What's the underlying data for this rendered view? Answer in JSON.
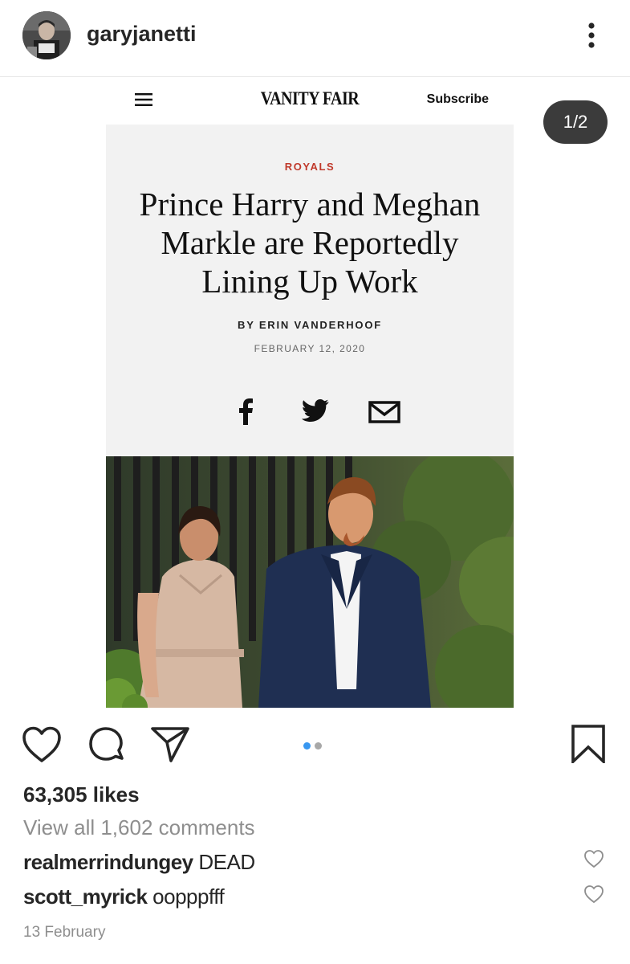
{
  "post": {
    "username": "garyjanetti",
    "slide_counter": "1/2",
    "slide_count": 2,
    "active_slide": 1,
    "accent_color": "#3897f0"
  },
  "article": {
    "publication": "VANITY FAIR",
    "subscribe_label": "Subscribe",
    "kicker": "ROYALS",
    "headline_lines": [
      "Prince Harry and Meghan",
      "Markle are Reportedly",
      "Lining Up Work"
    ],
    "byline": "BY ERIN VANDERHOOF",
    "date": "FEBRUARY 12, 2020",
    "kicker_color": "#c0392b"
  },
  "engagement": {
    "likes": "63,305 likes",
    "view_all_comments": "View all 1,602 comments",
    "timestamp": "13 February"
  },
  "comments": [
    {
      "author": "realmerrindungey",
      "text": "DEAD"
    },
    {
      "author": "scott_myrick",
      "text": "oopppfff"
    }
  ],
  "icons": {
    "header": [
      "avatar",
      "more-vertical-icon"
    ],
    "article": [
      "hamburger-menu-icon",
      "facebook-icon",
      "twitter-icon",
      "mail-icon"
    ],
    "actions": [
      "heart-icon",
      "comment-icon",
      "share-icon",
      "bookmark-icon"
    ]
  }
}
